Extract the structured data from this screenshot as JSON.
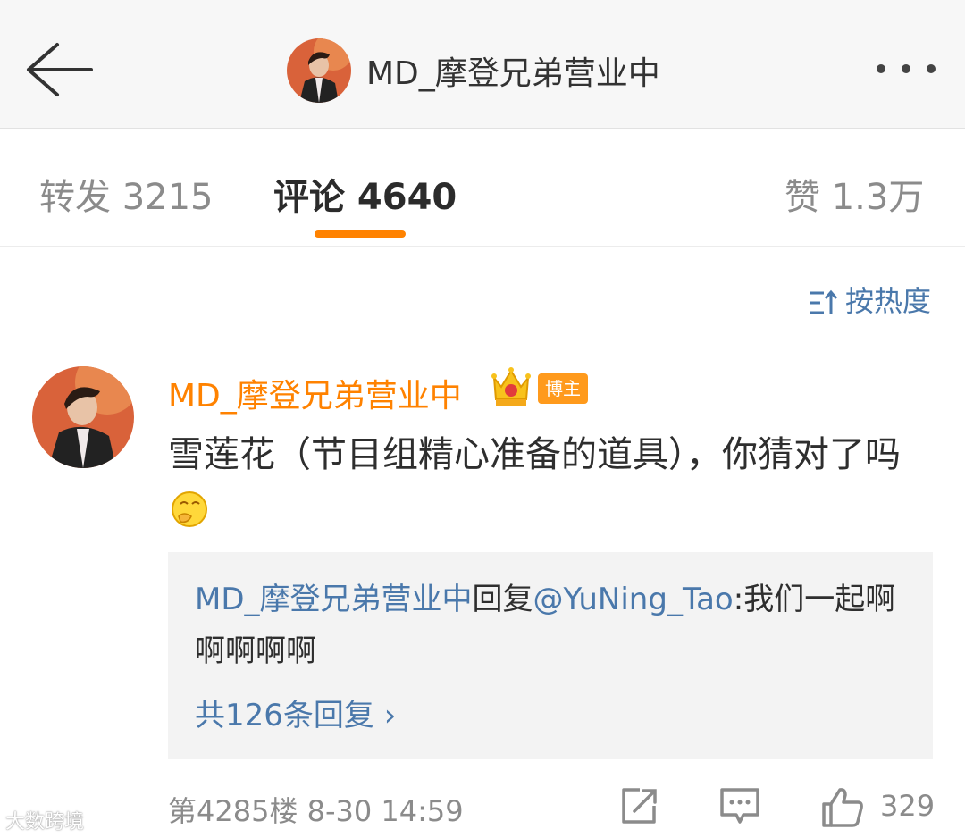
{
  "header": {
    "title": "MD_摩登兄弟营业中"
  },
  "tabs": [
    {
      "label": "转发 3215"
    },
    {
      "label": "评论 4640"
    },
    {
      "label": "赞 1.3万"
    }
  ],
  "sort": {
    "label": "按热度"
  },
  "comment": {
    "author": "MD_摩登兄弟营业中",
    "badge": "博主",
    "text": "雪莲花（节目组精心准备的道具），你猜对了吗",
    "reply": {
      "author": "MD_摩登兄弟营业中",
      "verb": "回复",
      "mention": "@YuNing_Tao",
      "text": ":我们一起啊啊啊啊啊",
      "more": "共126条回复 ›"
    },
    "floor": "第4285楼",
    "time": "8-30 14:59",
    "like_count": "329"
  },
  "watermark": "大数跨境",
  "colors": {
    "accent": "#ff8200",
    "link": "#4a78ab"
  }
}
